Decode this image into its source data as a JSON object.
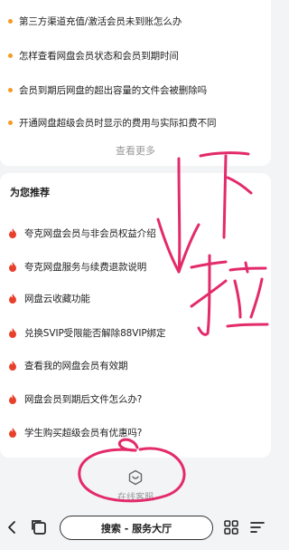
{
  "faq": {
    "items": [
      "第三方渠道充值/激活会员未到账怎么办",
      "怎样查看网盘会员状态和会员到期时间",
      "会员到期后网盘的超出容量的文件会被删除吗",
      "开通网盘超级会员时显示的费用与实际扣费不同"
    ],
    "more_label": "查看更多"
  },
  "recommend": {
    "title": "为您推荐",
    "items": [
      "夸克网盘会员与非会员权益介绍",
      "夸克网盘服务与续费退款说明",
      "网盘云收藏功能",
      "兑换SVIP受限能否解除88VIP绑定",
      "查看我的网盘会员有效期",
      "网盘会员到期后文件怎么办?",
      "学生购买超级会员有优惠吗?"
    ]
  },
  "customer_service": {
    "label": "在线客服"
  },
  "bottombar": {
    "search_label": "搜索 - 服务大厅"
  },
  "annotation": {
    "text": "下拉"
  },
  "colors": {
    "bullet": "#f59a23",
    "flame": "#e8402a",
    "ink": "#e32a6a"
  },
  "icons": {
    "bullet": "orange-dot",
    "recommend": "flame-icon",
    "customer_service": "headset-cube-icon",
    "back": "back-arrow-icon",
    "tabs": "tabs-icon",
    "apps": "apps-grid-icon",
    "menu": "menu-icon"
  }
}
